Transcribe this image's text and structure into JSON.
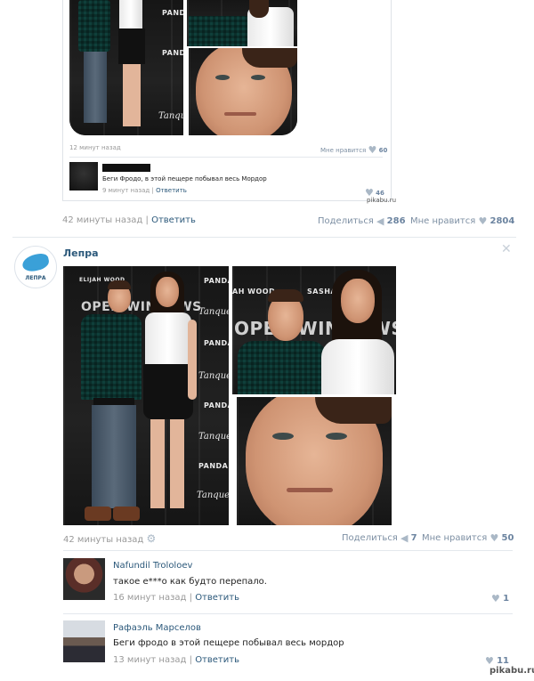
{
  "nested_post": {
    "meta_time": "12 минут назад",
    "likes_label": "Мне нравится",
    "likes_count": "60",
    "comment": {
      "text": "Беги Фродо, в этой пещере побывал весь Мордор",
      "time": "9 минут назад",
      "reply": "Ответить",
      "likes": "46"
    },
    "watermark": "pikabu.ru"
  },
  "post1_footer": {
    "time": "42 минуты назад",
    "reply": "Ответить",
    "share_label": "Поделиться",
    "share_count": "286",
    "likes_label": "Мне нравится",
    "likes_count": "2804"
  },
  "post2": {
    "group_name": "Лепра",
    "avatar_text": "ЛЕПРА",
    "close_icon": "close-icon",
    "photo_text": {
      "elijah_wood": "ELIJAH WOOD",
      "elijah_wood_crop": "AH WOOD",
      "sasha": "SASHA",
      "panda": "PANDA",
      "tanqueray": "Tanqueray",
      "openwindows": "OPEN WINDOWS"
    },
    "time": "42 минуты назад",
    "settings_icon": "gear-icon",
    "share_label": "Поделиться",
    "share_count": "7",
    "likes_label": "Мне нравится",
    "likes_count": "50",
    "comments": [
      {
        "author": "Nafundil Trololoev",
        "text": "такое е***о как будто перепало.",
        "time": "16 минут назад",
        "reply": "Ответить",
        "likes": "1"
      },
      {
        "author": "Рафаэль Марселов",
        "text": "Беги фродо в этой пещере побывал весь мордор",
        "time": "13 минут назад",
        "reply": "Ответить",
        "likes": "11"
      }
    ]
  },
  "watermark_bottom": "pikabu.ru",
  "colors": {
    "link": "#2b587a",
    "muted": "#999999",
    "likes": "#6c84a0",
    "divider": "#e4e8ed"
  }
}
